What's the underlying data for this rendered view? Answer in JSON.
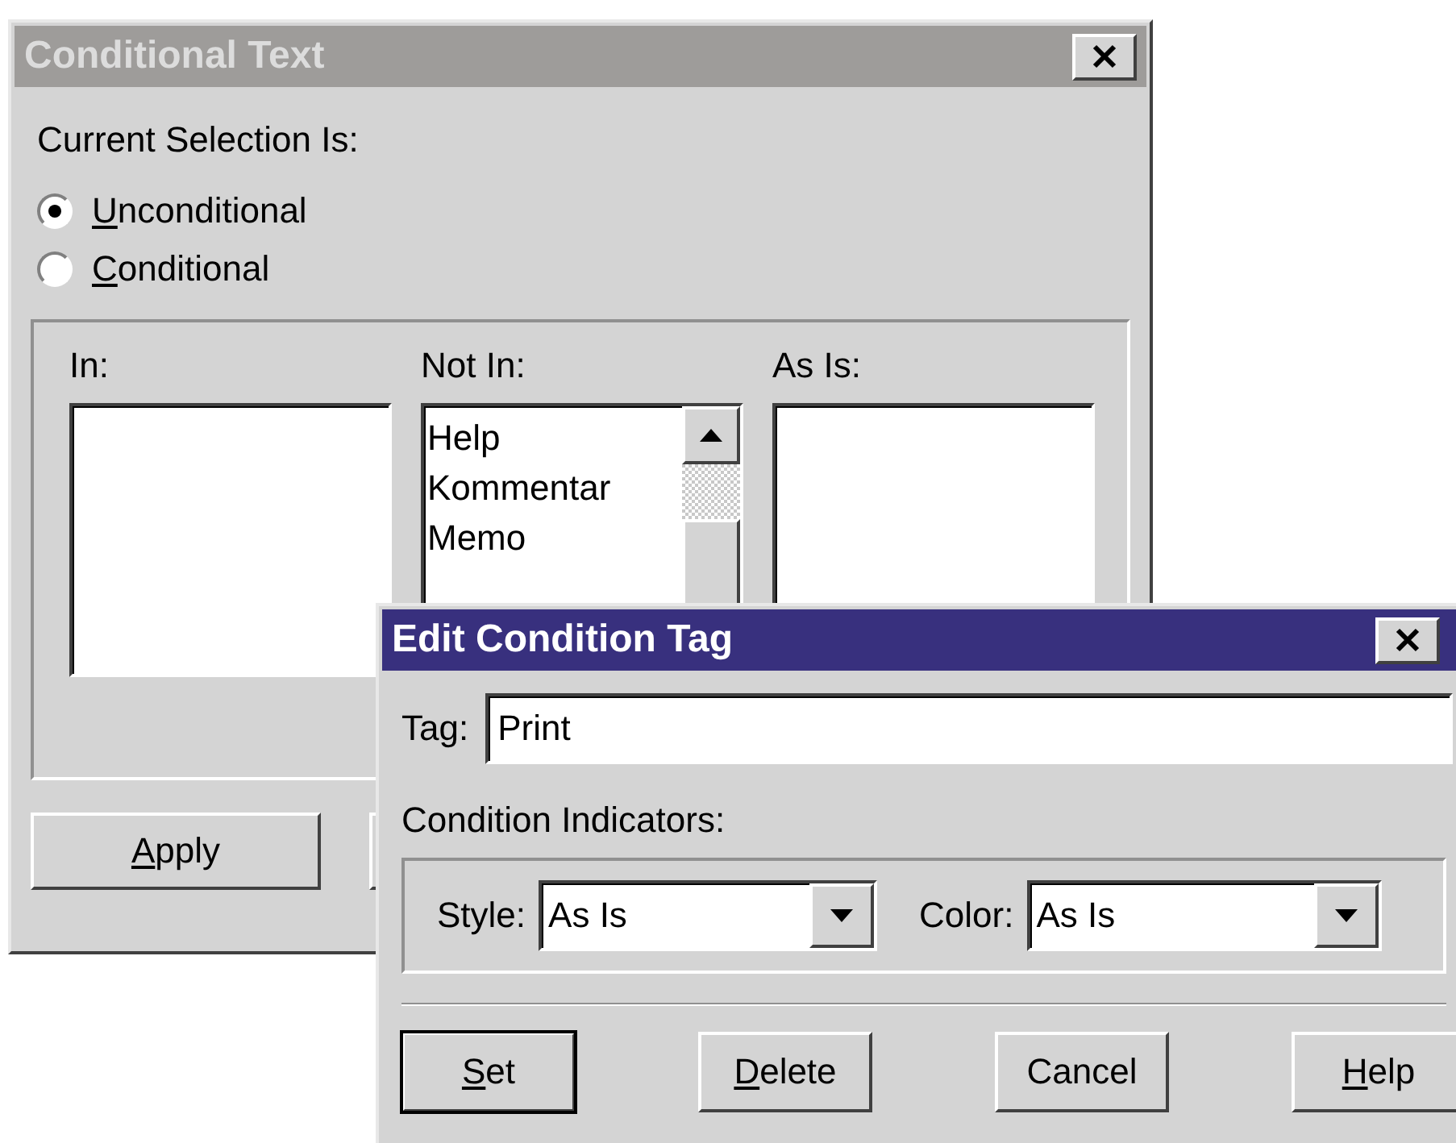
{
  "conditional_text": {
    "window": {
      "title": "Conditional Text",
      "active": false
    },
    "selection_label": "Current Selection Is:",
    "radios": [
      {
        "key": "U",
        "rest": "nconditional",
        "selected": true
      },
      {
        "key": "C",
        "rest": "onditional",
        "selected": false
      }
    ],
    "lists": [
      {
        "label": "In:"
      },
      {
        "label": "Not In:",
        "items": [
          "Help",
          "Kommentar",
          "Memo"
        ],
        "scrollbar": true
      },
      {
        "label": "As Is:"
      }
    ],
    "buttons": [
      {
        "key": "A",
        "rest": "pply"
      }
    ]
  },
  "edit_condition_tag": {
    "window": {
      "title": "Edit Condition Tag",
      "active": true
    },
    "tag": {
      "label": "Tag:",
      "value": "Print"
    },
    "indicators_label": "Condition Indicators:",
    "dropdowns": [
      {
        "label": "Style:",
        "value": "As Is"
      },
      {
        "label": "Color:",
        "value": "As Is"
      }
    ],
    "buttons": [
      {
        "key": "S",
        "rest": "et",
        "default": true
      },
      {
        "key": "D",
        "rest": "elete",
        "default": false
      },
      {
        "rest": "Cancel",
        "default": false
      },
      {
        "key": "H",
        "rest": "elp",
        "default": false
      }
    ]
  }
}
